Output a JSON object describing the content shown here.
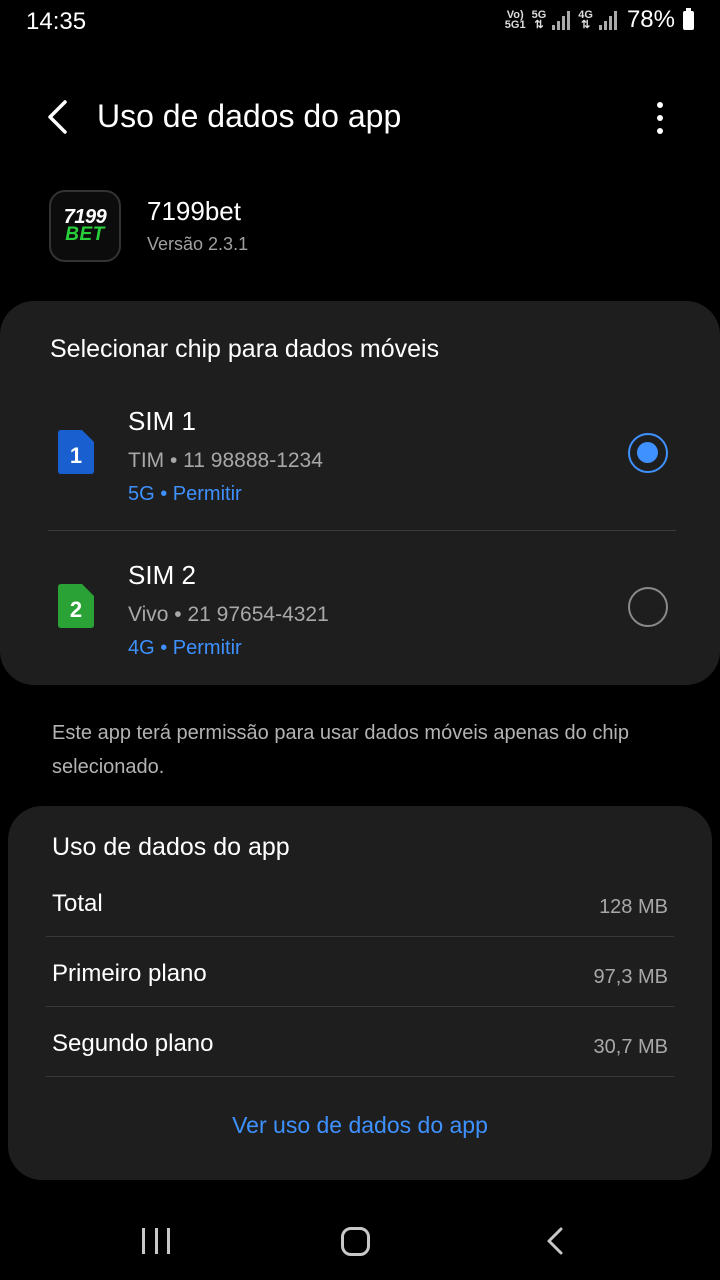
{
  "status_bar": {
    "time": "14:35",
    "volte": "Vo)",
    "volte_sub": "5G1",
    "sim1_net": "5G",
    "sim2_net": "4G",
    "battery": "78%"
  },
  "header": {
    "title": "Uso de dados do app",
    "back_icon": "back-arrow-icon",
    "more_icon": "more-options-icon"
  },
  "app": {
    "name": "7199bet",
    "version": "Versão 2.3.1",
    "icon_line1": "7199",
    "icon_line2": "BET"
  },
  "sim_card": {
    "title": "Selecionar chip para dados móveis",
    "sims": [
      {
        "slot": "1",
        "name": "SIM 1",
        "carrier": "TIM • 11 98888-1234",
        "network": "5G • Permitir",
        "selected": true,
        "color": "#1a5fd0"
      },
      {
        "slot": "2",
        "name": "SIM 2",
        "carrier": "Vivo • 21 97654-4321",
        "network": "4G • Permitir",
        "selected": false,
        "color": "#2aa235"
      }
    ]
  },
  "note": "Este app terá permissão para usar dados móveis apenas do chip selecionado.",
  "usage": {
    "title": "Uso de dados do app",
    "rows": [
      {
        "label": "Total",
        "value": "128 MB"
      },
      {
        "label": "Primeiro plano",
        "value": "97,3 MB"
      },
      {
        "label": "Segundo plano",
        "value": "30,7 MB"
      }
    ],
    "link": "Ver uso de dados do app"
  },
  "colors": {
    "accent": "#3e91ff",
    "card_bg": "#1e1e1e",
    "background": "#000000"
  }
}
